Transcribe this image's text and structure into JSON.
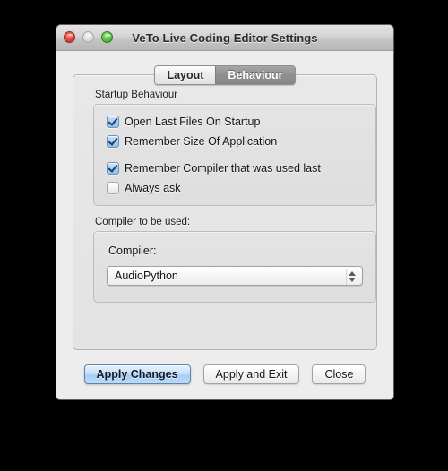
{
  "window": {
    "title": "VeTo Live Coding Editor Settings",
    "traffic_lights": [
      {
        "name": "close-button",
        "color": "#cf3a2e",
        "label": "Close"
      },
      {
        "name": "minimize-button",
        "color": "#d3d3d3",
        "label": "Minimize"
      },
      {
        "name": "zoom-button",
        "color": "#4fb03a",
        "label": "Zoom"
      }
    ]
  },
  "tabs": [
    {
      "label": "Layout",
      "active": false
    },
    {
      "label": "Behaviour",
      "active": true
    }
  ],
  "startup_group": {
    "label": "Startup Behaviour",
    "checkboxes": [
      {
        "label": "Open Last Files On Startup",
        "checked": true
      },
      {
        "label": "Remember Size Of Application",
        "checked": true
      },
      {
        "label": "Remember Compiler that was used last",
        "checked": true
      },
      {
        "label": "Always ask",
        "checked": false
      }
    ]
  },
  "compiler_group": {
    "label": "Compiler to be used:",
    "caption": "Compiler:",
    "selected": "AudioPython",
    "options": [
      "AudioPython"
    ]
  },
  "buttons": [
    {
      "label": "Apply Changes",
      "style": "default"
    },
    {
      "label": "Apply and Exit",
      "style": "normal"
    },
    {
      "label": "Close",
      "style": "normal"
    }
  ],
  "colors": {
    "accent": "#a8cdf2",
    "checkbox_fill": "#a9cdef",
    "active_tab": "#8f8f8f",
    "window_bg": "#ededed"
  }
}
